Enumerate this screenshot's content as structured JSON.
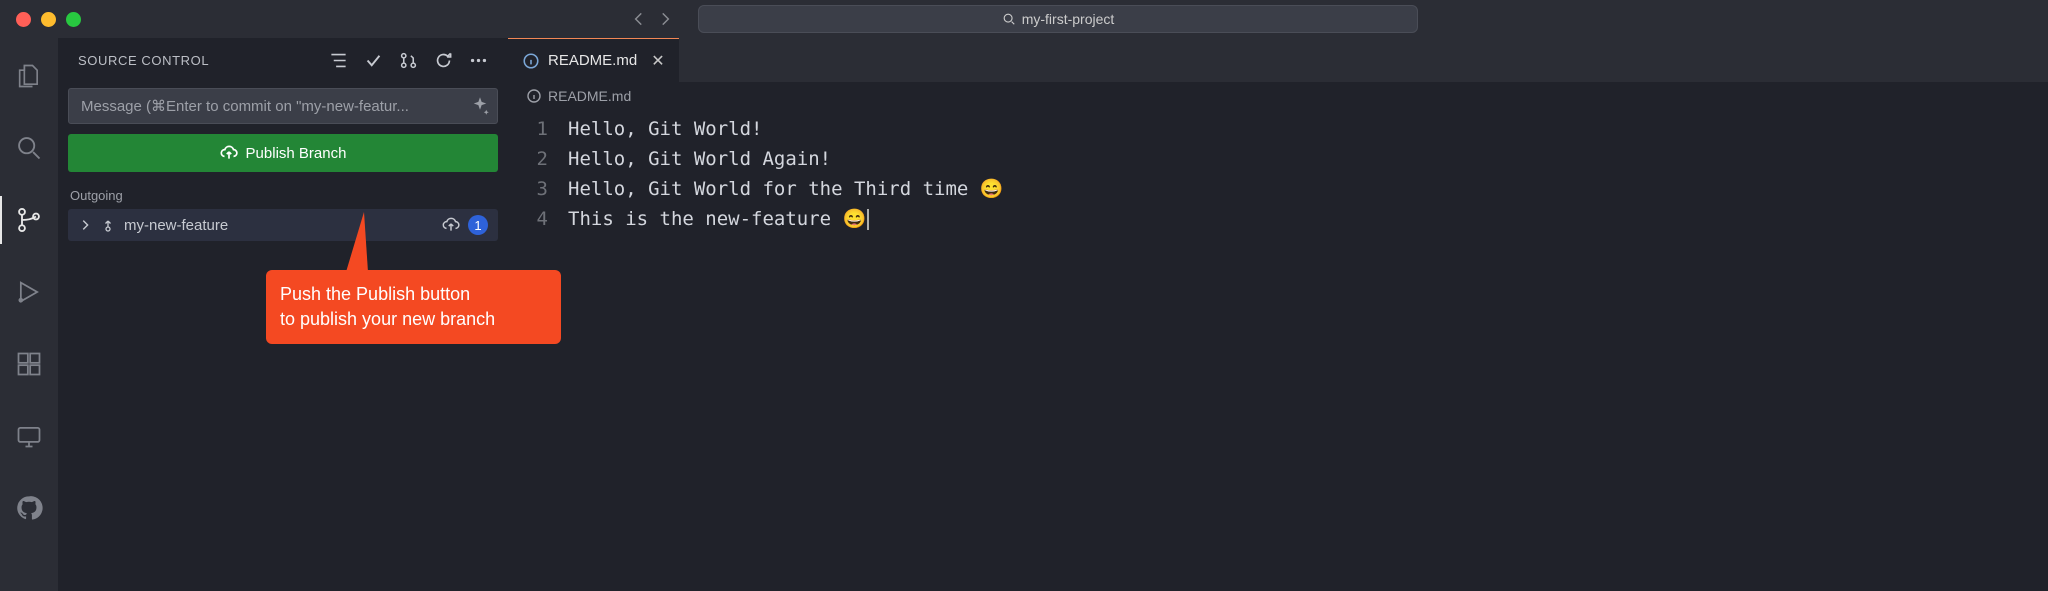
{
  "titlebar": {
    "search_text": "my-first-project"
  },
  "panel": {
    "title": "SOURCE CONTROL",
    "commit_placeholder": "Message (⌘Enter to commit on \"my-new-featur...",
    "publish_label": "Publish Branch",
    "outgoing_label": "Outgoing",
    "branch_name": "my-new-feature",
    "outgoing_count": "1"
  },
  "callout": {
    "line1": "Push the Publish button",
    "line2": "to publish your new branch"
  },
  "editor": {
    "tab_label": "README.md",
    "breadcrumb": "README.md",
    "lines": [
      {
        "num": "1",
        "text": "Hello, Git World!"
      },
      {
        "num": "2",
        "text": "Hello, Git World Again!"
      },
      {
        "num": "3",
        "text": "Hello, Git World for the Third time 😄"
      },
      {
        "num": "4",
        "text": "This is the new-feature 😄"
      }
    ]
  },
  "icons": {
    "explorer": "explorer-icon",
    "search": "search-icon",
    "scm": "source-control-icon",
    "debug": "run-debug-icon",
    "extensions": "extensions-icon",
    "remote": "remote-explorer-icon",
    "github": "github-icon"
  }
}
